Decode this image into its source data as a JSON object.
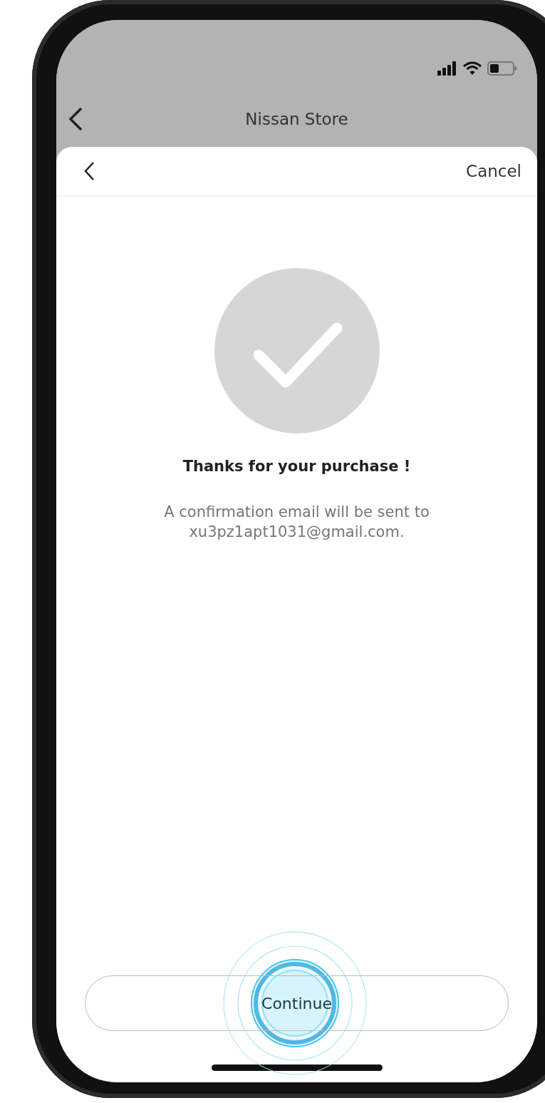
{
  "header": {
    "title": "Nissan Store"
  },
  "sheet": {
    "cancel_label": "Cancel"
  },
  "confirmation": {
    "title": "Thanks for your purchase !",
    "message": "A confirmation email will be sent to\nxu3pz1apt1031@gmail.com."
  },
  "primary_button": {
    "label": "Continue"
  }
}
